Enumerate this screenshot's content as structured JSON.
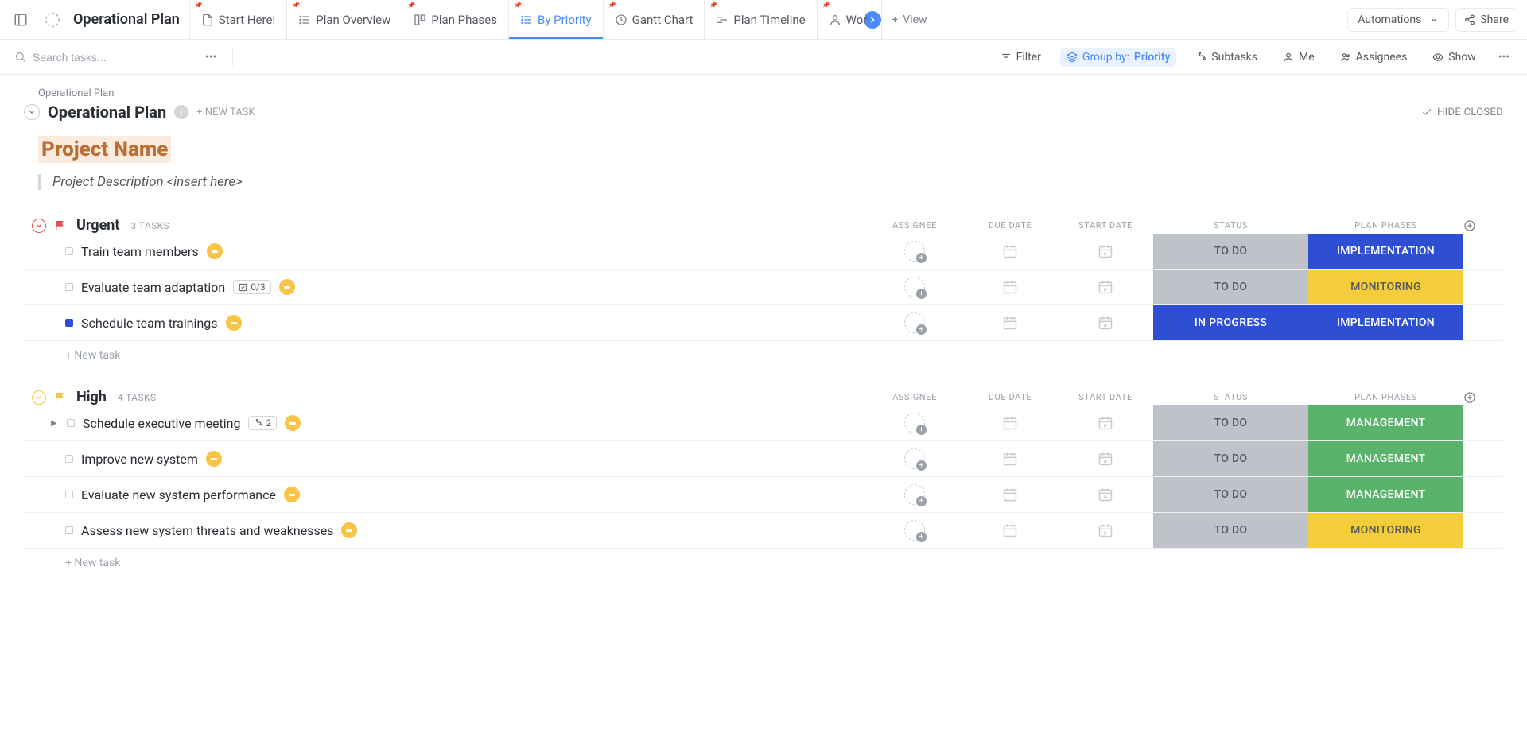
{
  "workspace": {
    "title": "Operational Plan"
  },
  "tabs": [
    {
      "label": "Start Here!"
    },
    {
      "label": "Plan Overview"
    },
    {
      "label": "Plan Phases"
    },
    {
      "label": "By Priority"
    },
    {
      "label": "Gantt Chart"
    },
    {
      "label": "Plan Timeline"
    },
    {
      "label": "Wor"
    }
  ],
  "view_new": "View",
  "automations": "Automations",
  "share": "Share",
  "search": {
    "placeholder": "Search tasks..."
  },
  "toolbar": {
    "filter": "Filter",
    "groupby_label": "Group by:",
    "groupby_value": "Priority",
    "subtasks": "Subtasks",
    "me": "Me",
    "assignees": "Assignees",
    "show": "Show"
  },
  "breadcrumb": "Operational Plan",
  "space_title": "Operational Plan",
  "new_task_label": "+ NEW TASK",
  "hide_closed": "HIDE CLOSED",
  "project": {
    "name": "Project Name",
    "description": "Project Description <insert here>"
  },
  "columns": {
    "assignee": "ASSIGNEE",
    "due": "DUE DATE",
    "start": "START DATE",
    "status": "STATUS",
    "phase": "PLAN PHASES"
  },
  "groups": [
    {
      "name": "Urgent",
      "count": "3 TASKS",
      "flag_color": "#e04f4f",
      "tasks": [
        {
          "name": "Train team members",
          "status": "TO DO",
          "status_class": "status-todo",
          "phase": "IMPLEMENTATION",
          "phase_class": "phase-impl",
          "dot_class": ""
        },
        {
          "name": "Evaluate team adaptation",
          "subtask": "0/3",
          "status": "TO DO",
          "status_class": "status-todo",
          "phase": "MONITORING",
          "phase_class": "phase-mon",
          "dot_class": ""
        },
        {
          "name": "Schedule team trainings",
          "status": "IN PROGRESS",
          "status_class": "status-inprog",
          "phase": "IMPLEMENTATION",
          "phase_class": "phase-impl",
          "dot_class": "inprog"
        }
      ]
    },
    {
      "name": "High",
      "count": "4 TASKS",
      "flag_color": "#f0c94a",
      "tasks": [
        {
          "name": "Schedule executive meeting",
          "link_count": "2",
          "expandable": true,
          "status": "TO DO",
          "status_class": "status-todo",
          "phase": "MANAGEMENT",
          "phase_class": "phase-mgmt",
          "dot_class": ""
        },
        {
          "name": "Improve new system",
          "status": "TO DO",
          "status_class": "status-todo",
          "phase": "MANAGEMENT",
          "phase_class": "phase-mgmt",
          "dot_class": ""
        },
        {
          "name": "Evaluate new system performance",
          "status": "TO DO",
          "status_class": "status-todo",
          "phase": "MANAGEMENT",
          "phase_class": "phase-mgmt",
          "dot_class": ""
        },
        {
          "name": "Assess new system threats and weaknesses",
          "status": "TO DO",
          "status_class": "status-todo",
          "phase": "MONITORING",
          "phase_class": "phase-mon",
          "dot_class": ""
        }
      ]
    }
  ],
  "new_task_row": "+ New task"
}
